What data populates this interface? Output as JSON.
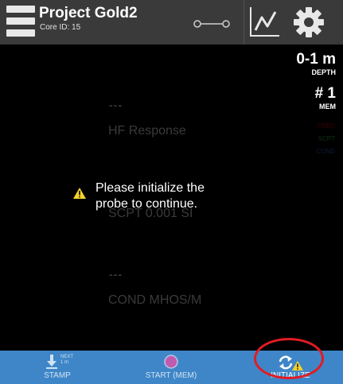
{
  "header": {
    "title": "Project Gold2",
    "subtitle": "Core ID: 15",
    "icons": [
      "menu-icon",
      "probe-connection-icon",
      "graph-icon",
      "gear-icon"
    ]
  },
  "readouts": {
    "depth_value": "0-1 m",
    "depth_label": "DEPTH",
    "mem_value": "# 1",
    "mem_label": "MEM"
  },
  "legend": {
    "items": [
      {
        "label": "FREQ",
        "color": "#3a0000"
      },
      {
        "label": "SCPT",
        "color": "#0e300e"
      },
      {
        "label": "COND",
        "color": "#101a3a"
      }
    ]
  },
  "channels": [
    {
      "value": "---",
      "label": "HF Response"
    },
    {
      "value": "---",
      "label": "SCPT 0.001 SI"
    },
    {
      "value": "---",
      "label": "COND MHOS/M"
    }
  ],
  "message": {
    "icon": "warning-icon",
    "text": "Please initialize the probe to continue."
  },
  "footer": {
    "stamp": {
      "sub": "NEXT\n1 m",
      "label": "STAMP"
    },
    "start": {
      "label": "START (MEM)"
    },
    "initialize": {
      "label": "INITIALIZE"
    }
  },
  "colors": {
    "header_bg": "#3a3a3a",
    "footer_bg": "#3f86c8",
    "warning": "#f3d12b",
    "highlight_ring": "#e21b22",
    "record_dot": "#c05cb0"
  }
}
